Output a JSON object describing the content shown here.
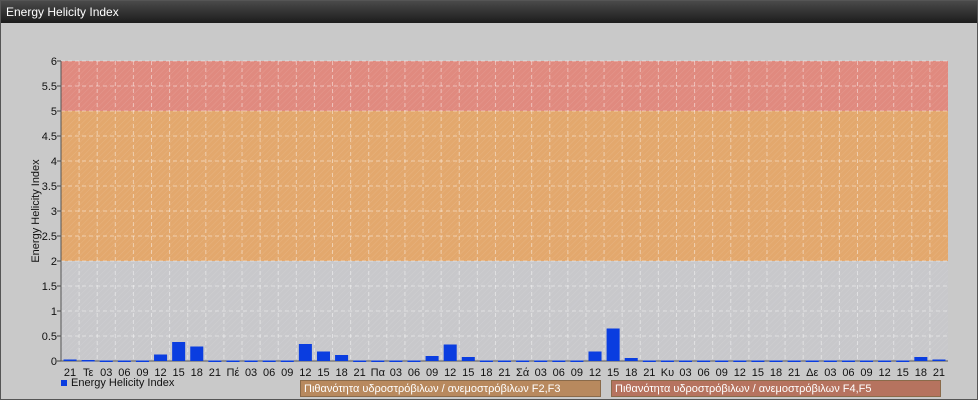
{
  "window": {
    "title": "Energy Helicity Index"
  },
  "legend": {
    "series_label": "Energy Helicity Index",
    "series_color": "#0a3de0"
  },
  "bands": [
    {
      "label": "Πιθανότητα υδροστρόβιλων / ανεμοστρόβιλων F2,F3",
      "range": [
        2,
        5
      ],
      "color": "#e5a667"
    },
    {
      "label": "Πιθανότητα υδροστρόβιλων / ανεμοστρόβιλων F4,F5",
      "range": [
        5,
        6
      ],
      "color": "#e2877a"
    }
  ],
  "chart_data": {
    "type": "bar",
    "ylabel": "Energy Helicity Index",
    "ylim": [
      0,
      6
    ],
    "yticks": [
      0,
      0.5,
      1,
      1.5,
      2,
      2.5,
      3,
      3.5,
      4,
      4.5,
      5,
      5.5,
      6
    ],
    "grid": true,
    "categories": [
      "21",
      "Τε",
      "03",
      "06",
      "09",
      "12",
      "15",
      "18",
      "21",
      "Πέ",
      "03",
      "06",
      "09",
      "12",
      "15",
      "18",
      "21",
      "Πα",
      "03",
      "06",
      "09",
      "12",
      "15",
      "18",
      "21",
      "Σά",
      "03",
      "06",
      "09",
      "12",
      "15",
      "18",
      "21",
      "Κυ",
      "03",
      "06",
      "09",
      "12",
      "15",
      "18",
      "21",
      "Δε",
      "03",
      "06",
      "09",
      "12",
      "15",
      "18",
      "21"
    ],
    "series": [
      {
        "name": "Energy Helicity Index",
        "color": "#0a3de0",
        "values": [
          0.03,
          0.02,
          0.01,
          0.01,
          0.01,
          0.13,
          0.38,
          0.29,
          0.01,
          0.01,
          0.01,
          0.01,
          0.01,
          0.34,
          0.19,
          0.12,
          0.01,
          0.01,
          0.01,
          0.01,
          0.1,
          0.33,
          0.08,
          0.01,
          0.01,
          0.01,
          0.01,
          0.01,
          0.01,
          0.19,
          0.65,
          0.06,
          0.01,
          0.01,
          0.01,
          0.01,
          0.01,
          0.01,
          0.01,
          0.01,
          0.01,
          0.01,
          0.01,
          0.01,
          0.01,
          0.01,
          0.01,
          0.08,
          0.03
        ]
      }
    ]
  }
}
